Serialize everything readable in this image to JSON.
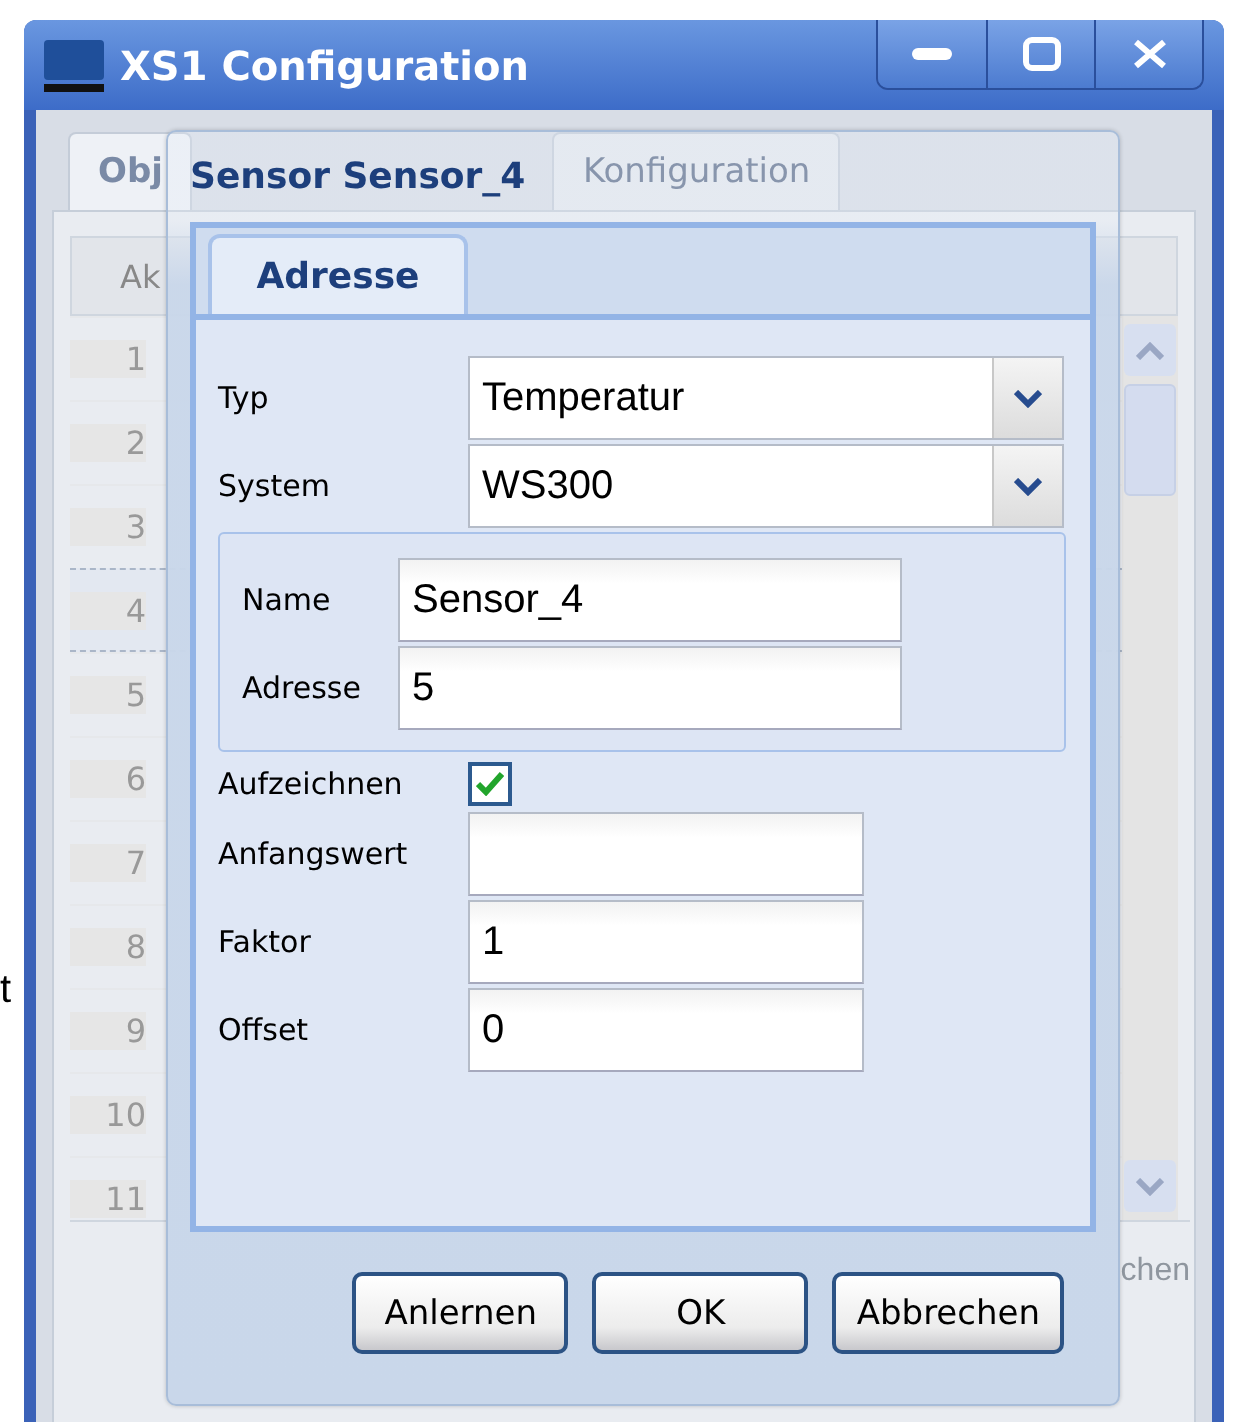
{
  "side_text": "t",
  "window": {
    "title": "XS1 Configuration"
  },
  "background_tabs": [
    {
      "label": "Obj",
      "selected": true
    },
    {
      "label": "Konfiguration",
      "selected": false
    }
  ],
  "list": {
    "column_1": "Ak",
    "rows": [
      {
        "number": "1",
        "selected": false
      },
      {
        "number": "2",
        "selected": false
      },
      {
        "number": "3",
        "selected": false
      },
      {
        "number": "4",
        "selected": true
      },
      {
        "number": "5",
        "selected": false
      },
      {
        "number": "6",
        "selected": false
      },
      {
        "number": "7",
        "selected": false
      },
      {
        "number": "8",
        "selected": false
      },
      {
        "number": "9",
        "selected": false
      },
      {
        "number": "10",
        "selected": false
      },
      {
        "number": "11",
        "selected": false
      }
    ]
  },
  "bottom_button": "chen",
  "dialog": {
    "title": "Sensor Sensor_4",
    "tabs": [
      {
        "label": "Adresse",
        "selected": true
      }
    ],
    "fields": [
      {
        "kind": "select",
        "label": "Typ",
        "value": "Temperatur"
      },
      {
        "kind": "select",
        "label": "System",
        "value": "WS300"
      },
      {
        "kind": "group",
        "fields": [
          {
            "kind": "text",
            "label": "Name",
            "value": "Sensor_4"
          },
          {
            "kind": "text",
            "label": "Adresse",
            "value": "5"
          }
        ]
      },
      {
        "kind": "checkbox",
        "label": "Aufzeichnen",
        "checked": true
      },
      {
        "kind": "text",
        "label": "Anfangswert"
      },
      {
        "kind": "text",
        "label": "Faktor",
        "value": "1"
      },
      {
        "kind": "text",
        "label": "Offset",
        "value": "0"
      }
    ],
    "buttons": [
      "Anlernen",
      "OK",
      "Abbrechen"
    ]
  }
}
